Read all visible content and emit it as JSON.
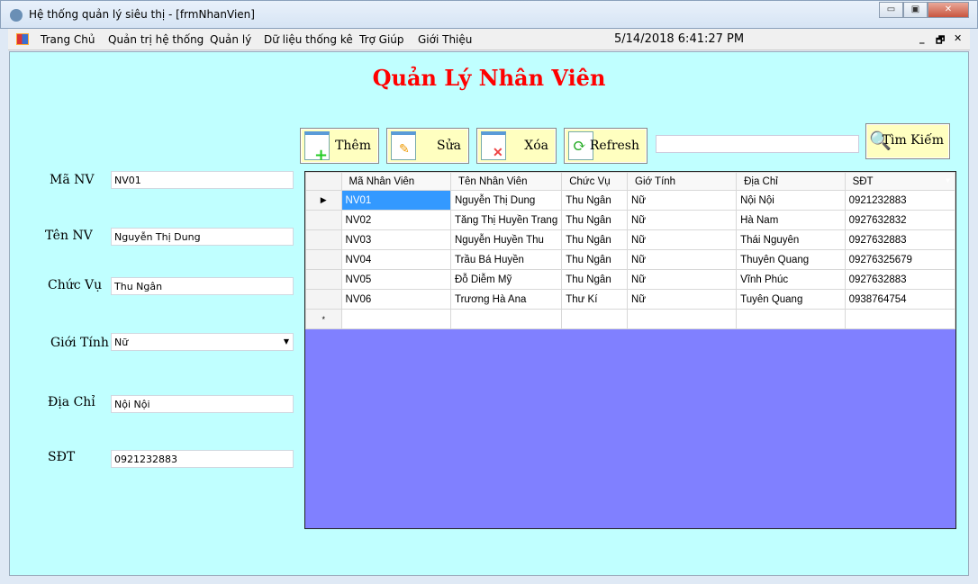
{
  "window": {
    "title": "Hệ thống quản lý siêu thị - [frmNhanVien]",
    "min": "▭",
    "max": "▣",
    "close": "✕"
  },
  "menu": {
    "items": [
      "Trang Chủ",
      "Quản trị hệ thống",
      "Quản lý",
      "Dữ liệu thống kê",
      "Trợ Giúp",
      "Giới Thiệu"
    ],
    "clock": "5/14/2018 6:41:27 PM",
    "mdi_min": "_",
    "mdi_restore": "🗗",
    "mdi_close": "✕"
  },
  "heading": "Quản Lý Nhân Viên",
  "form": {
    "ma_label": "Mã NV",
    "ma_value": "NV01",
    "ten_label": "Tên NV",
    "ten_value": "Nguyễn Thị Dung",
    "chucvu_label": "Chức Vụ",
    "chucvu_value": "Thu Ngân",
    "gioitinh_label": "Giới Tính",
    "gioitinh_value": "Nữ",
    "diachi_label": "Địa Chỉ",
    "diachi_value": "Nội Nội",
    "sdt_label": "SĐT",
    "sdt_value": "0921232883"
  },
  "toolbar": {
    "add": "Thêm",
    "edit": "Sửa",
    "delete": "Xóa",
    "refresh": "Refresh",
    "search": "Tìm Kiếm",
    "search_value": ""
  },
  "grid": {
    "headers": [
      "Mã Nhân Viên",
      "Tên Nhân Viên",
      "Chức Vụ",
      "Giớ Tính",
      "Địa Chỉ",
      "SĐT"
    ],
    "rows": [
      [
        "NV01",
        "Nguyễn Thị Dung",
        "Thu Ngân",
        "Nữ",
        "Nội Nội",
        "0921232883"
      ],
      [
        "NV02",
        "Tăng Thị Huyền Trang",
        "Thu Ngân",
        "Nữ",
        "Hà Nam",
        "0927632832"
      ],
      [
        "NV03",
        "Nguyễn Huyền Thu",
        "Thu Ngân",
        "Nữ",
        "Thái Nguyên",
        "0927632883"
      ],
      [
        "NV04",
        "Trầu Bá Huyền",
        "Thu Ngân",
        "Nữ",
        "Thuyên Quang",
        "09276325679"
      ],
      [
        "NV05",
        "Đỗ Diễm Mỹ",
        "Thu Ngân",
        "Nữ",
        "Vĩnh Phúc",
        "0927632883"
      ],
      [
        "NV06",
        "Trương Hà Ana",
        "Thư Kí",
        "Nữ",
        "Tuyên Quang",
        "0938764754"
      ]
    ],
    "current_marker": "▶",
    "new_marker": "*"
  }
}
